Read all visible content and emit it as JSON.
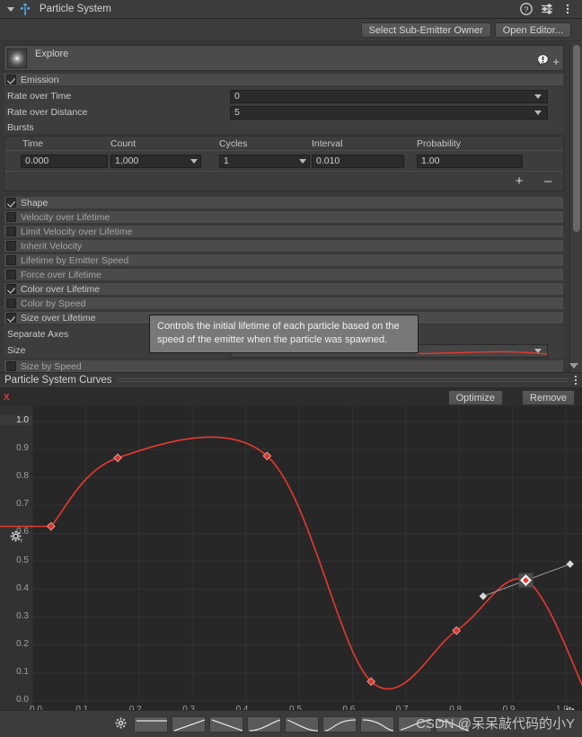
{
  "window": {
    "title": "Particle System",
    "icons": {
      "foldout": "triangle-down-icon",
      "logo": "particle-system-icon",
      "help": "help-icon",
      "preset": "preset-sliders-icon",
      "menu": "kebab-menu-icon"
    }
  },
  "toolbar": {
    "select_sub_emitter_owner": "Select Sub-Emitter Owner",
    "open_editor": "Open Editor..."
  },
  "emitter": {
    "name": "Explore",
    "warning_icon": "warning-bubble-icon",
    "add_label": "+"
  },
  "modules": [
    {
      "label": "Emission",
      "checked": true
    },
    {
      "label": "Shape",
      "checked": true
    },
    {
      "label": "Velocity over Lifetime",
      "checked": false
    },
    {
      "label": "Limit Velocity over Lifetime",
      "checked": false
    },
    {
      "label": "Inherit Velocity",
      "checked": false
    },
    {
      "label": "Lifetime by Emitter Speed",
      "checked": false
    },
    {
      "label": "Force over Lifetime",
      "checked": false
    },
    {
      "label": "Color over Lifetime",
      "checked": true
    },
    {
      "label": "Color by Speed",
      "checked": false
    },
    {
      "label": "Size over Lifetime",
      "checked": true
    },
    {
      "label": "Size by Speed",
      "checked": false
    }
  ],
  "emission": {
    "rate_over_time": {
      "label": "Rate over Time",
      "value": "0"
    },
    "rate_over_distance": {
      "label": "Rate over Distance",
      "value": "5"
    },
    "bursts_label": "Bursts",
    "bursts_columns": [
      "Time",
      "Count",
      "Cycles",
      "Interval",
      "Probability"
    ],
    "bursts_rows": [
      {
        "time": "0.000",
        "count": "1,000",
        "cycles": "1",
        "interval": "0.010",
        "probability": "1.00"
      }
    ],
    "add_burst": "+",
    "remove_burst": "–"
  },
  "size_over_lifetime": {
    "separate_axes_label": "Separate Axes",
    "separate_axes_checked": false,
    "size_label": "Size"
  },
  "tooltip": {
    "text": "Controls the initial lifetime of each particle based on the speed of the emitter when the particle was spawned."
  },
  "curves_panel": {
    "title": "Particle System Curves",
    "axis_tag": "X",
    "optimize_label": "Optimize",
    "remove_label": "Remove",
    "menu_icon": "kebab-menu-icon",
    "gear_left_icon": "gear-icon",
    "gear_right_icon": "gear-icon"
  },
  "chart_data": {
    "type": "line",
    "title": "Particle System Curves",
    "xlabel": "",
    "ylabel": "",
    "xlim": [
      0.0,
      1.0
    ],
    "ylim": [
      0.0,
      1.0
    ],
    "grid": true,
    "legend": "none",
    "curve_color": "#e8392f",
    "x_ticks": [
      "0.0",
      "0.1",
      "0.2",
      "0.3",
      "0.4",
      "0.5",
      "0.6",
      "0.7",
      "0.8",
      "0.9",
      "1.0"
    ],
    "y_ticks": [
      "0.0",
      "0.1",
      "0.2",
      "0.3",
      "0.4",
      "0.5",
      "0.6",
      "0.7",
      "0.8",
      "0.9",
      "1.0"
    ],
    "series": [
      {
        "name": "Size over Lifetime",
        "keyframes": [
          {
            "x": 0.035,
            "y": 0.625,
            "selected": false
          },
          {
            "x": 0.16,
            "y": 0.87,
            "selected": false
          },
          {
            "x": 0.44,
            "y": 0.877,
            "selected": false
          },
          {
            "x": 0.635,
            "y": 0.07,
            "selected": false
          },
          {
            "x": 0.795,
            "y": 0.252,
            "selected": false
          },
          {
            "x": 0.925,
            "y": 0.432,
            "selected": true
          },
          {
            "x": 1.04,
            "y": 0.018,
            "selected": false
          }
        ],
        "tangent_handles": [
          {
            "x": 0.845,
            "y": 0.375
          },
          {
            "x": 1.008,
            "y": 0.49
          }
        ]
      }
    ]
  },
  "presets": {
    "gear_icon": "gear-icon",
    "items": [
      "constant-curve-preset",
      "linear-up-curve-preset",
      "linear-down-curve-preset",
      "ease-in-curve-preset",
      "ease-out-curve-preset",
      "ease-in-out-up-curve-preset",
      "ease-in-out-down-curve-preset",
      "ramp-up-curve-preset",
      "ramp-down-curve-preset"
    ]
  },
  "watermark": {
    "text": "CSDN @呆呆敲代码的小Y"
  }
}
